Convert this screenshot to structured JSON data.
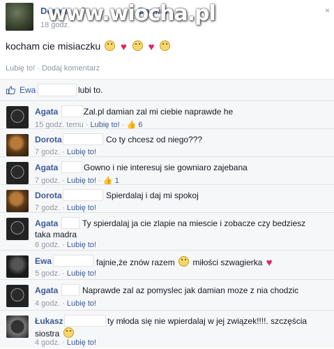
{
  "watermark": "www.wiocha.pl",
  "post": {
    "author": "Dorota",
    "target": "Damian",
    "time": "18 godz.",
    "text": "kocham cie misiaczku",
    "like_action": "Lubię to!",
    "separator": " · ",
    "comment_action": "Dodaj komentarz",
    "close_glyph": "×"
  },
  "likes": {
    "name": "Ewa",
    "suffix": "lubi to."
  },
  "comments": [
    {
      "name": "Agata",
      "text": "Zal.pl damian zal mi ciebie naprawde he",
      "time": "15 godz. temu",
      "like_label": "Lubię to!",
      "likes": "6"
    },
    {
      "name": "Dorota",
      "text": "Co ty chcesz od niego???",
      "time": "7 godz.",
      "like_label": "Lubię to!"
    },
    {
      "name": "Agata",
      "text": "Gowno i nie interesuj sie gowniaro zajebana",
      "time": "7 godz.",
      "like_label": "Lubię to!",
      "likes": "1"
    },
    {
      "name": "Dorota",
      "text": "Spierdalaj i daj mi spokoj",
      "time": "7 godz.",
      "like_label": "Lubię to!"
    },
    {
      "name": "Agata",
      "text": "Ty spierdalaj ja cie zlapie na miescie i zobacze czy bedziesz",
      "text2": "taka madra",
      "time": "6 godz.",
      "like_label": "Lubię to!"
    },
    {
      "name": "Ewa",
      "text": "fajnie,że znów razem",
      "text_b": "miłości szwagierka",
      "time": "5 godz.",
      "like_label": "Lubię to!"
    },
    {
      "name": "Agata",
      "text": "Naprawde zal az pomyslec jak damian moze z nia chodzic",
      "time": "4 godz.",
      "like_label": "Lubię to!"
    },
    {
      "name": "Łukasz",
      "text": "ty młoda się nie wpierdalaj w jej związek!!!!. szczęścia",
      "text2": "siostra",
      "time": "4 godz.",
      "like_label": "Lubię to!"
    }
  ],
  "colors": {
    "link": "#3b5998",
    "muted": "#9197a3",
    "comment_bg": "#f6f7f8"
  }
}
